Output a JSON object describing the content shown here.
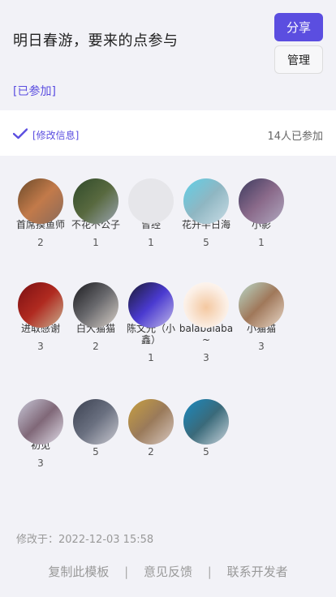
{
  "header": {
    "title": "明日春游，要来的点参与",
    "share_label": "分享",
    "manage_label": "管理",
    "joined_label": "[已参加]"
  },
  "info_bar": {
    "edit_label": "[修改信息]",
    "count_label": "14人已参加"
  },
  "participants": [
    {
      "name": "首席摸鱼师",
      "count": "2"
    },
    {
      "name": "不花不公子",
      "count": "1"
    },
    {
      "name": "曾经",
      "count": "1"
    },
    {
      "name": "花开半日海",
      "count": "5"
    },
    {
      "name": "小影",
      "count": "1"
    },
    {
      "name": "进取感谢",
      "count": "3"
    },
    {
      "name": "白大猫猫",
      "count": "2"
    },
    {
      "name": "陈文光（小鑫）",
      "count": "1"
    },
    {
      "name": "balabalaba~",
      "count": "3"
    },
    {
      "name": "小猫猫",
      "count": "3"
    },
    {
      "name": "初见",
      "count": "3"
    },
    {
      "name": "",
      "count": "5"
    },
    {
      "name": "",
      "count": "2"
    },
    {
      "name": "",
      "count": "5"
    }
  ],
  "footer": {
    "modified": "修改于：2022-12-03 15:58",
    "copy_template": "复制此模板",
    "feedback": "意见反馈",
    "contact": "联系开发者",
    "separator": "|"
  },
  "colors": {
    "accent": "#5b4ee0"
  }
}
